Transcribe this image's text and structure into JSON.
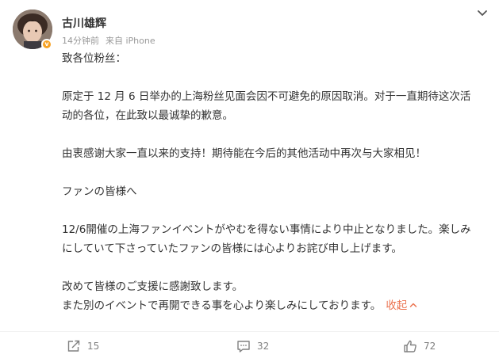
{
  "post": {
    "author": "古川雄辉",
    "time": "14分钟前",
    "source": "来自 iPhone",
    "paragraphs": {
      "p1": "致各位粉丝：",
      "p2a": "原定于 12 月 6 日举办的上海粉丝见面会因不可避免的原因取消。对于一直期待这次活",
      "p2b": "动的各位，在此致以最诚挚的歉意。",
      "p3": "由衷感谢大家一直以来的支持！期待能在今后的其他活动中再次与大家相见！",
      "p4": "ファンの皆様へ",
      "p5a": "12/6開催の上海ファンイベントがやむを得ない事情により中止となりました。楽しみ",
      "p5b": "にしていて下さっていたファンの皆様には心よりお詫び申し上げます。",
      "p6a": "改めて皆様のご支援に感謝致します。",
      "p6b": "また別のイベントで再開できる事を心より楽しみにしております。"
    },
    "collapse_label": "收起"
  },
  "actions": {
    "repost_count": "15",
    "comment_count": "32",
    "like_count": "72"
  },
  "colors": {
    "accent": "#eb7350",
    "verified_badge": "#f7a224",
    "meta_text": "#999999"
  },
  "icons": {
    "menu": "chevron-down-icon",
    "repost": "share-icon",
    "comment": "comment-icon",
    "like": "thumbs-up-icon"
  }
}
